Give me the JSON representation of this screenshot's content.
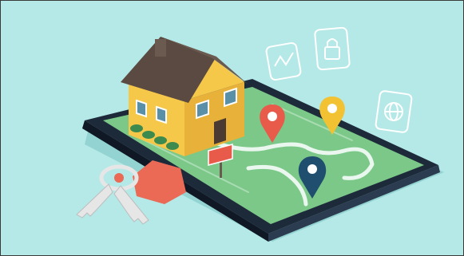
{
  "scene": {
    "background_color": "#b4e9e7",
    "frame_color": "#3a3a3a",
    "phone_color": "#1d2a3a",
    "map_color": "#7cc888",
    "road_color": "#e9f7ee",
    "house_wall_color": "#f5c84a",
    "house_roof_color": "#5a4a42",
    "pins": [
      {
        "name": "pin-red",
        "color": "#e85a4a"
      },
      {
        "name": "pin-yellow",
        "color": "#f2c233"
      },
      {
        "name": "pin-navy",
        "color": "#1f4e6e"
      }
    ],
    "floating_icons": [
      {
        "name": "chart-icon"
      },
      {
        "name": "lock-icon"
      },
      {
        "name": "globe-icon"
      }
    ],
    "keys_color": "#e6e6e6",
    "key_tag_color": "#ea6a55",
    "sign_color": "#e85a4a"
  }
}
